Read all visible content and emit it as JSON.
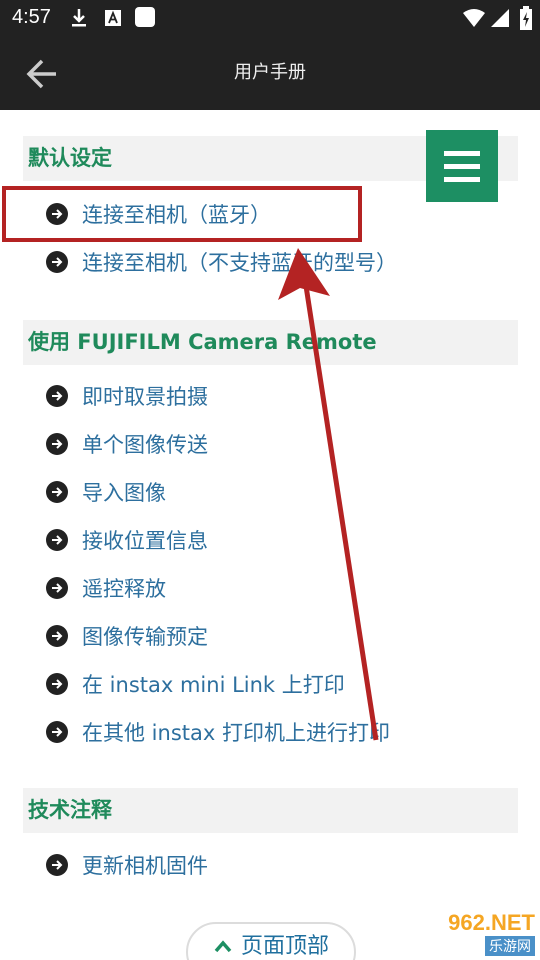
{
  "status_bar": {
    "time": "4:57"
  },
  "app_bar": {
    "title": "用户手册"
  },
  "sections": [
    {
      "header": "默认设定",
      "items": [
        "连接至相机（蓝牙）",
        "连接至相机（不支持蓝牙的型号）"
      ]
    },
    {
      "header": "使用 FUJIFILM Camera Remote",
      "items": [
        "即时取景拍摄",
        "单个图像传送",
        "导入图像",
        "接收位置信息",
        "遥控释放",
        "图像传输预定",
        "在 instax mini Link 上打印",
        "在其他 instax 打印机上进行打印"
      ]
    },
    {
      "header": "技术注释",
      "items": [
        "更新相机固件"
      ]
    }
  ],
  "top_button": {
    "label": "页面顶部"
  },
  "watermark": {
    "main": "962.NET",
    "sub": "乐游网"
  },
  "colors": {
    "accent": "#1d8f63",
    "link": "#2d6f9e",
    "highlight": "#b42323"
  }
}
